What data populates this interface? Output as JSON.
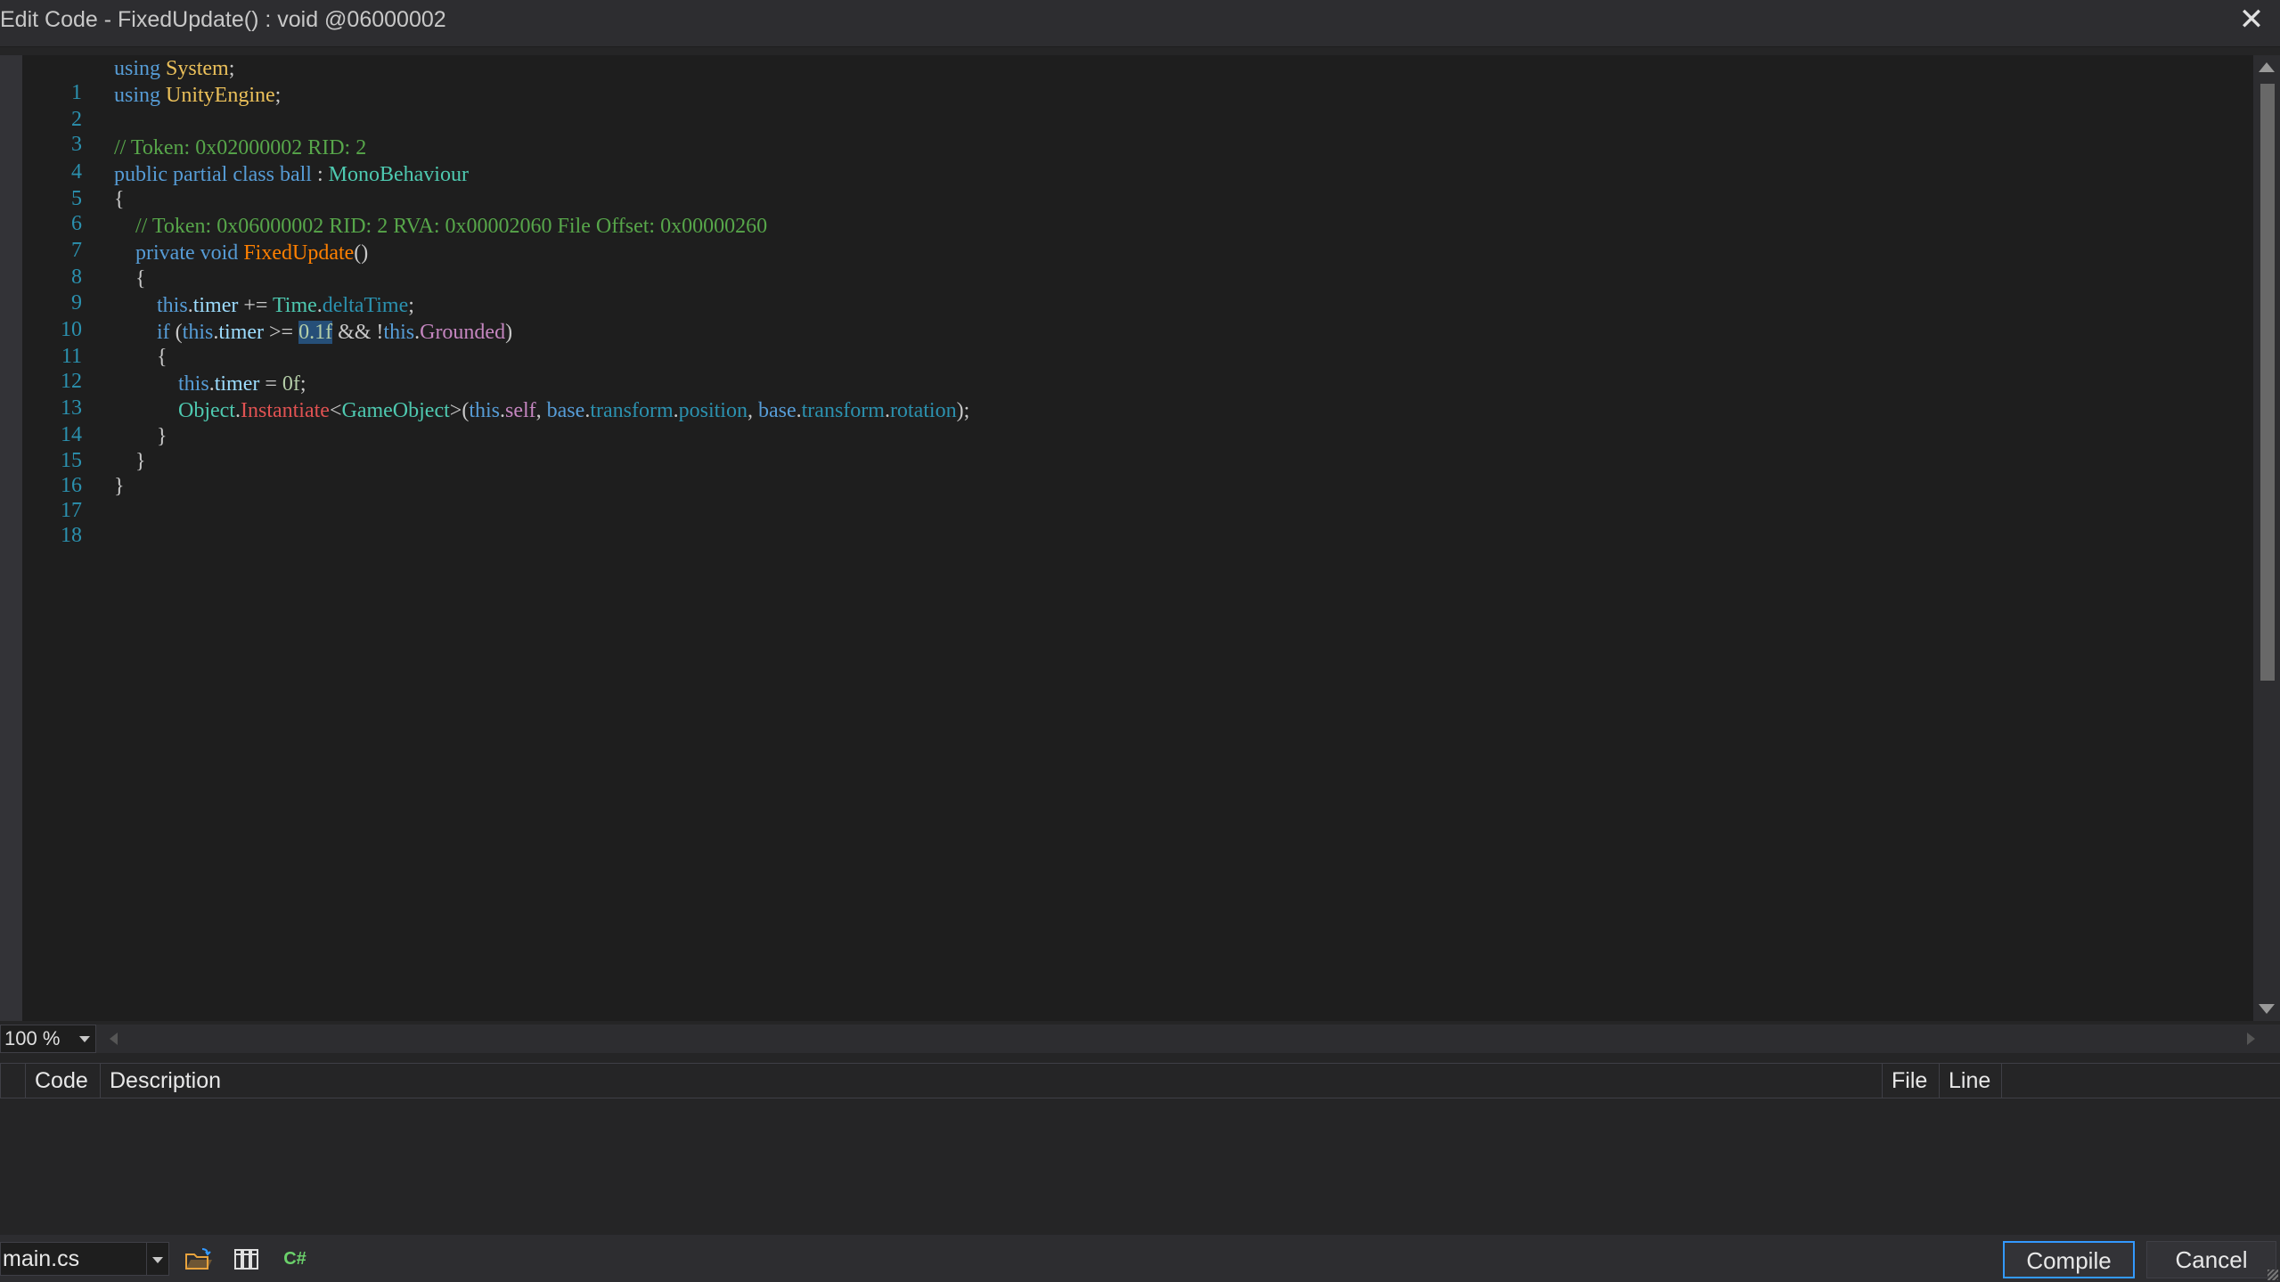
{
  "window": {
    "title": "Edit Code - FixedUpdate() : void @06000002",
    "close_label": "✕"
  },
  "editor": {
    "language": "C#",
    "selected_text": "0.1f",
    "lines": [
      {
        "n": "1",
        "text": "using System;"
      },
      {
        "n": "2",
        "text": "using UnityEngine;"
      },
      {
        "n": "3",
        "text": ""
      },
      {
        "n": "4",
        "text": "// Token: 0x02000002 RID: 2"
      },
      {
        "n": "5",
        "text": "public partial class ball : MonoBehaviour"
      },
      {
        "n": "6",
        "text": "{"
      },
      {
        "n": "7",
        "text": "    // Token: 0x06000002 RID: 2 RVA: 0x00002060 File Offset: 0x00000260"
      },
      {
        "n": "8",
        "text": "    private void FixedUpdate()"
      },
      {
        "n": "9",
        "text": "    {"
      },
      {
        "n": "10",
        "text": "        this.timer += Time.deltaTime;"
      },
      {
        "n": "11",
        "text": "        if (this.timer >= 0.1f && !this.Grounded)"
      },
      {
        "n": "12",
        "text": "        {"
      },
      {
        "n": "13",
        "text": "            this.timer = 0f;"
      },
      {
        "n": "14",
        "text": "            Object.Instantiate<GameObject>(this.self, base.transform.position, base.transform.rotation);"
      },
      {
        "n": "15",
        "text": "        }"
      },
      {
        "n": "16",
        "text": "    }"
      },
      {
        "n": "17",
        "text": "}"
      },
      {
        "n": "18",
        "text": ""
      }
    ]
  },
  "zoom": {
    "value": "100 %"
  },
  "errors": {
    "columns": {
      "code": "Code",
      "description": "Description",
      "file": "File",
      "line": "Line"
    },
    "rows": []
  },
  "bottom": {
    "file": "main.cs",
    "icons": [
      "open-folder-icon",
      "references-icon",
      "csharp-icon"
    ],
    "csharp_label": "C#",
    "compile_label": "Compile",
    "cancel_label": "Cancel"
  },
  "colors": {
    "background": "#1e1e1e",
    "chrome": "#2d2d30",
    "keyword": "#569cd6",
    "type": "#4ec9b0",
    "comment": "#57a64a",
    "method": "#ff8000",
    "selection": "#264f78",
    "accent": "#3399ff"
  }
}
